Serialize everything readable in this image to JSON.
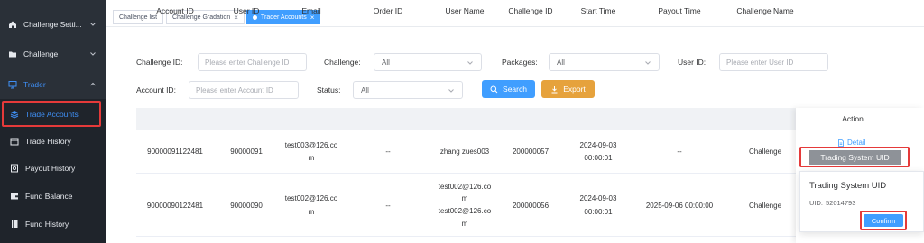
{
  "sidebar": {
    "items": [
      {
        "label": "Challenge Setti...",
        "icon": "home-icon"
      },
      {
        "label": "Challenge",
        "icon": "folder-icon"
      },
      {
        "label": "Trader",
        "icon": "monitor-icon"
      },
      {
        "label": "Trade Accounts",
        "icon": "layers-icon"
      },
      {
        "label": "Trade History",
        "icon": "calendar-icon"
      },
      {
        "label": "Payout History",
        "icon": "payout-icon"
      },
      {
        "label": "Fund Balance",
        "icon": "wallet-icon"
      },
      {
        "label": "Fund History",
        "icon": "book-icon"
      }
    ]
  },
  "tabs": [
    {
      "label": "Challenge list"
    },
    {
      "label": "Challenge Gradation"
    },
    {
      "label": "Trader Accounts"
    }
  ],
  "filters": {
    "challenge_id_label": "Challenge ID:",
    "challenge_id_placeholder": "Please enter Challenge ID",
    "challenge_label": "Challenge:",
    "challenge_value": "All",
    "packages_label": "Packages:",
    "packages_value": "All",
    "user_id_label": "User ID:",
    "user_id_placeholder": "Please enter User ID",
    "account_id_label": "Account ID:",
    "account_id_placeholder": "Please enter Account ID",
    "status_label": "Status:",
    "status_value": "All",
    "search_label": "Search",
    "export_label": "Export"
  },
  "table": {
    "headers": [
      "Account ID",
      "User ID",
      "Email",
      "Order ID",
      "User Name",
      "Challenge ID",
      "Start Time",
      "Payout Time",
      "Challenge Name",
      "Action"
    ],
    "rows": [
      {
        "account_id": "90000091122481",
        "user_id": "90000091",
        "email": [
          "test003@126.co",
          "m"
        ],
        "order_id": "--",
        "user_name": [
          "zhang zues003"
        ],
        "challenge_id": "200000057",
        "start_time": [
          "2024-09-03",
          "00:00:01"
        ],
        "payout_time": "--",
        "challenge_name": "Challenge"
      },
      {
        "account_id": "90000090122481",
        "user_id": "90000090",
        "email": [
          "test002@126.co",
          "m"
        ],
        "order_id": "--",
        "user_name": [
          "test002@126.co",
          "m",
          "test002@126.co",
          "m"
        ],
        "challenge_id": "200000056",
        "start_time": [
          "2024-09-03",
          "00:00:01"
        ],
        "payout_time": "2025-09-06 00:00:00",
        "challenge_name": "Challenge"
      }
    ],
    "detail_label": "Detail",
    "trading_uid_button": "Trading System UID"
  },
  "popover": {
    "title": "Trading System UID",
    "uid_label": "UID:",
    "uid_value": "52014793",
    "confirm_label": "Confirm"
  },
  "colors": {
    "sidebar_bg": "#2a3038",
    "accent": "#409eff",
    "export": "#e6a23c",
    "highlight": "#e53a3a"
  }
}
